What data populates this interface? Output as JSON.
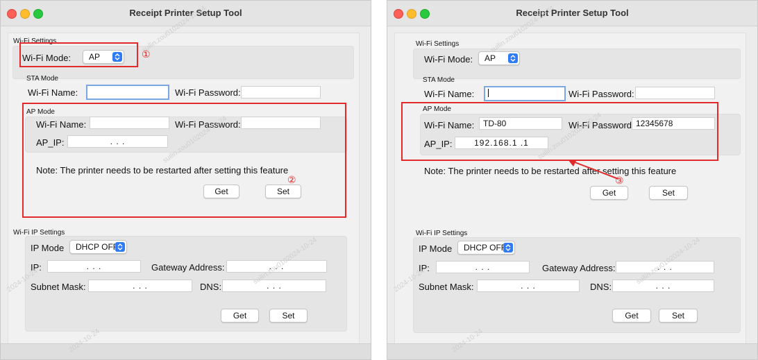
{
  "window_title": "Receipt Printer Setup Tool",
  "wifi_settings": {
    "group_label": "Wi-Fi Settings",
    "mode_label": "Wi-Fi Mode:",
    "mode_value": "AP"
  },
  "sta_mode": {
    "group_label": "STA Mode",
    "name_label": "Wi-Fi Name:",
    "name_value": "",
    "password_label": "Wi-Fi Password:",
    "password_value": ""
  },
  "ap_mode": {
    "group_label": "AP Mode",
    "name_label": "Wi-Fi Name:",
    "password_label": "Wi-Fi Password:",
    "ip_label": "AP_IP:",
    "left": {
      "name_value": "",
      "password_value": "",
      "ip_value": ". . ."
    },
    "right": {
      "name_value": "TD-80",
      "password_value": "12345678",
      "ip_value": "192.168.1 .1"
    }
  },
  "note": "Note: The printer needs to be restarted after setting this feature",
  "buttons": {
    "get": "Get",
    "set": "Set"
  },
  "ip_settings": {
    "group_label": "Wi-Fi IP Settings",
    "ip_mode_label": "IP Mode",
    "ip_mode_value": "DHCP OFF",
    "ip_label": "IP:",
    "ip_value": ". . .",
    "gateway_label": "Gateway Address:",
    "gateway_value": ". . .",
    "subnet_label": "Subnet Mask:",
    "subnet_value": ". . .",
    "dns_label": "DNS:",
    "dns_value": ". . ."
  },
  "annotations": {
    "one": "①",
    "two": "②",
    "three": "③"
  },
  "watermarks": [
    "suilin.zou0102024-10-24",
    "2024-10-24",
    "suilin.zou01"
  ],
  "colors": {
    "annotation": "#e22a2a",
    "select_accent": "#2f7bf6",
    "focus_ring": "#7aa7e0"
  }
}
